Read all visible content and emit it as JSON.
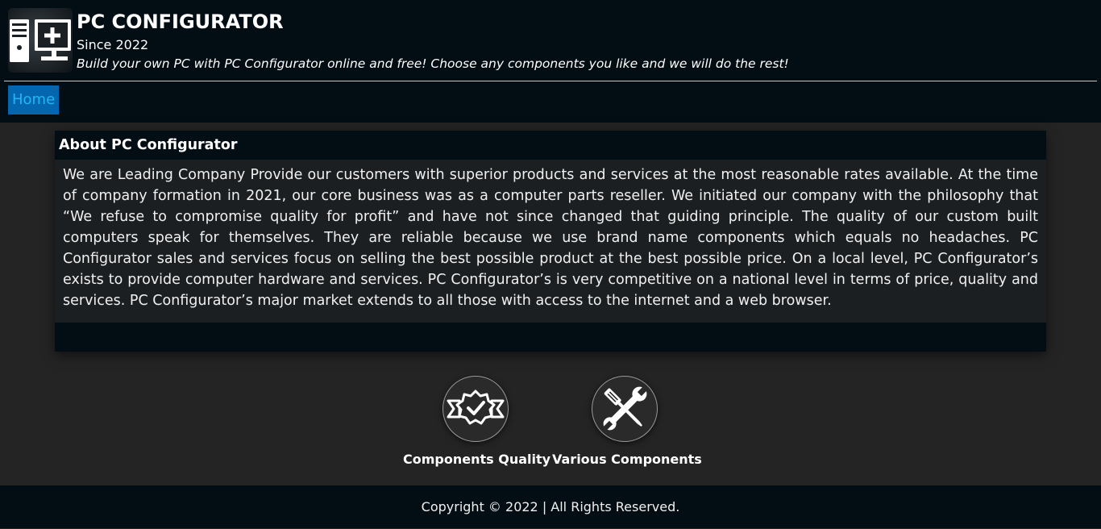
{
  "header": {
    "title": "PC CONFIGURATOR",
    "since": "Since 2022",
    "tagline": "Build your own PC with PC Configurator online and free! Choose any components you like and we will do the rest!",
    "logo_icon": "pc-monitor-plus-icon"
  },
  "nav": {
    "items": [
      {
        "label": "Home",
        "active": true
      }
    ]
  },
  "about": {
    "heading": "About PC Configurator",
    "body": "We are Leading Company Provide our customers with superior products and services at the most reasonable rates available. At the time of company formation in 2021, our core business was as a computer parts reseller. We initiated our company with the philosophy that “We refuse to compromise quality for profit” and have not since changed that guiding principle. The quality of our custom built computers speak for themselves. They are reliable because we use brand name components which equals no headaches. PC Configurator sales and services focus on selling the best possible product at the best possible price. On a local level, PC Configurator’s exists to provide computer hardware and services. PC Configurator’s is very competitive on a national level in terms of price, quality and services. PC Configurator’s major market extends to all those with access to the internet and a web browser."
  },
  "features": [
    {
      "label": "Components Quality",
      "icon": "quality-badge-check-icon"
    },
    {
      "label": "Various Components",
      "icon": "tools-wrench-screwdriver-icon"
    }
  ],
  "footer": {
    "copyright": "Copyright © 2022 | All Rights Reserved."
  },
  "colors": {
    "header_bg": "#030d14",
    "page_bg": "#242424",
    "card_bg": "#1c1f21",
    "nav_active_bg": "#0566b0",
    "nav_active_text": "#1fb8f5"
  }
}
